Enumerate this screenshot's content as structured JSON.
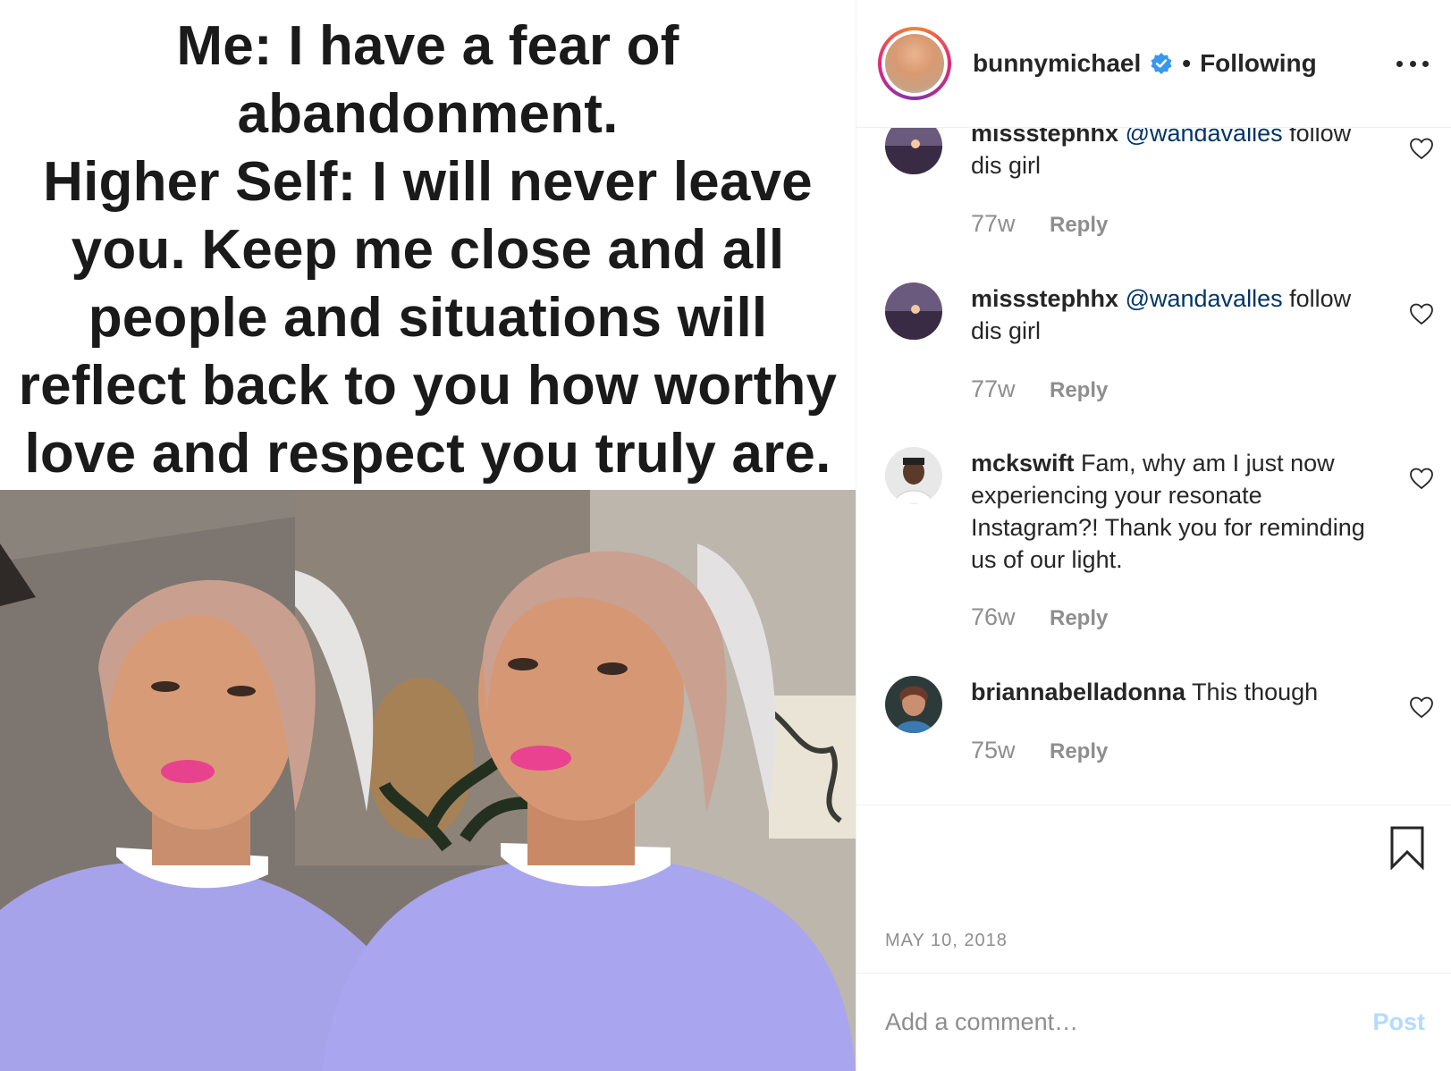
{
  "post": {
    "caption_image_text": "Me: I have a fear of\nabandonment.\nHigher Self: I will never leave\nyou. Keep me close and all\npeople and situations will\nreflect back to you how worthy\nlove and respect you truly are."
  },
  "header": {
    "username": "bunnymichael",
    "verified_icon": "verified-badge-icon",
    "separator": "•",
    "follow_status": "Following",
    "more_icon": "more-options-icon"
  },
  "comments": [
    {
      "username": "missstephhx",
      "mention": "@wandavalles",
      "text": " follow dis girl",
      "time": "77w",
      "reply_label": "Reply"
    },
    {
      "username": "missstephhx",
      "mention": "@wandavalles",
      "text": " follow dis girl",
      "time": "77w",
      "reply_label": "Reply"
    },
    {
      "username": "mckswift",
      "mention": "",
      "text": " Fam, why am I just now experiencing your resonate Instagram?! Thank you for reminding us of our light.",
      "time": "76w",
      "reply_label": "Reply"
    },
    {
      "username": "briannabelladonna",
      "mention": "",
      "text": " This though",
      "time": "75w",
      "reply_label": "Reply"
    }
  ],
  "actions": {
    "bookmark_icon": "bookmark-icon",
    "date": "MAY 10, 2018"
  },
  "composer": {
    "placeholder": "Add a comment…",
    "post_label": "Post"
  },
  "colors": {
    "mention": "#003569",
    "muted": "#8e8e8e",
    "post_disabled": "#b3dbff",
    "verified": "#3897f0"
  }
}
